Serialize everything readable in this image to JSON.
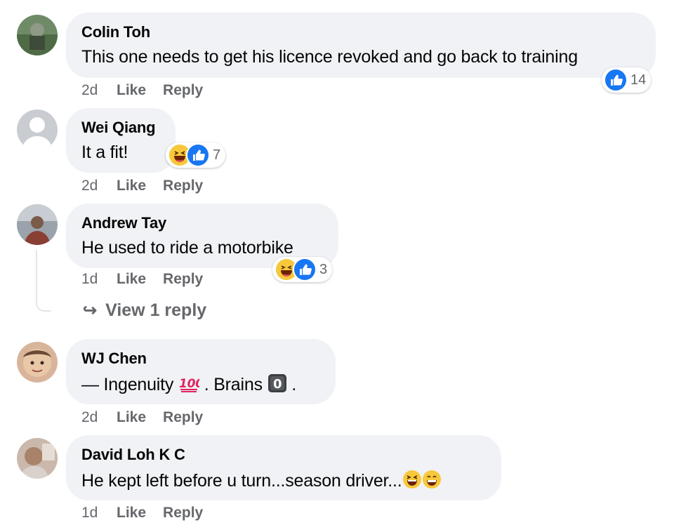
{
  "comments": [
    {
      "author": "Colin Toh",
      "text": "This one needs to get his licence revoked and go back to training",
      "time": "2d",
      "like": "Like",
      "reply": "Reply",
      "reaction_count": "14",
      "reaction_icons": [
        "like-icon"
      ]
    },
    {
      "author": "Wei Qiang",
      "text": "It a fit!",
      "time": "2d",
      "like": "Like",
      "reply": "Reply",
      "reaction_count": "7",
      "reaction_icons": [
        "haha-icon",
        "like-icon"
      ]
    },
    {
      "author": "Andrew Tay",
      "text": "He used to ride a motorbike",
      "time": "1d",
      "like": "Like",
      "reply": "Reply",
      "reaction_count": "3",
      "reaction_icons": [
        "haha-icon",
        "like-icon"
      ],
      "view_replies": "View 1 reply"
    },
    {
      "author": "WJ Chen",
      "text_parts": [
        "— Ingenuity ",
        " . Brains ",
        " ."
      ],
      "text_emojis": [
        "hundred-points-icon",
        "keycap-zero-icon"
      ],
      "time": "2d",
      "like": "Like",
      "reply": "Reply"
    },
    {
      "author": "David Loh K C",
      "text": "He kept left before u turn...season driver...",
      "text_emojis": [
        "grinning-squinting-face-icon",
        "beaming-face-icon"
      ],
      "time": "1d",
      "like": "Like",
      "reply": "Reply"
    }
  ],
  "colors": {
    "bubble_bg": "#f0f2f5",
    "meta_text": "#65676b",
    "like_blue": "#1877f2",
    "haha_yellow": "#f7c83b"
  }
}
